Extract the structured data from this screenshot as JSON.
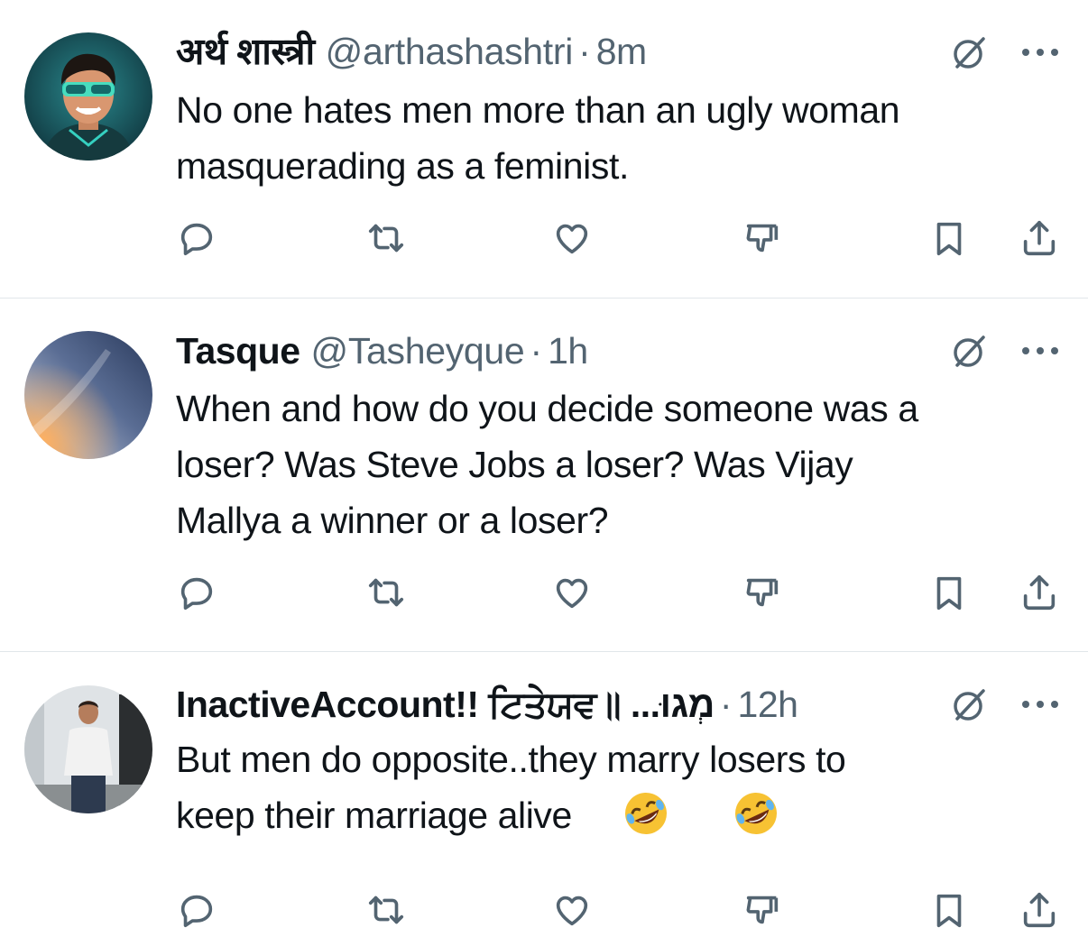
{
  "tweets": [
    {
      "name": "अर्थ शास्त्री",
      "handle": "@arthashashtri",
      "dot": "·",
      "time": "8m",
      "text": "No one hates men more than an ugly woman\nmasquerading as a feminist.",
      "avatar_icon": "cartoon-man-avatar"
    },
    {
      "name": "Tasque",
      "handle": "@Tasheyque",
      "dot": "·",
      "time": "1h",
      "text": "When and how do you decide someone was a\nloser? Was Steve Jobs a loser? Was Vijay\nMallya a winner or a loser?",
      "avatar_icon": "sky-gradient-avatar"
    },
    {
      "name": "InactiveAccount!! ਟਿਤੇਯਵ॥ ...מְגוּ",
      "handle": "",
      "dot": "·",
      "time": "12h",
      "text": "But men do opposite..they marry losers to\nkeep their marriage alive",
      "emojis": [
        "🤣",
        "🤣"
      ],
      "avatar_icon": "man-photo-avatar"
    }
  ],
  "actions": [
    "reply-icon",
    "retweet-icon",
    "like-icon",
    "downvote-icon",
    "bookmark-icon",
    "share-icon"
  ],
  "colors": {
    "text": "#0f1419",
    "secondary": "#536471",
    "divider": "#e1e6ea"
  }
}
